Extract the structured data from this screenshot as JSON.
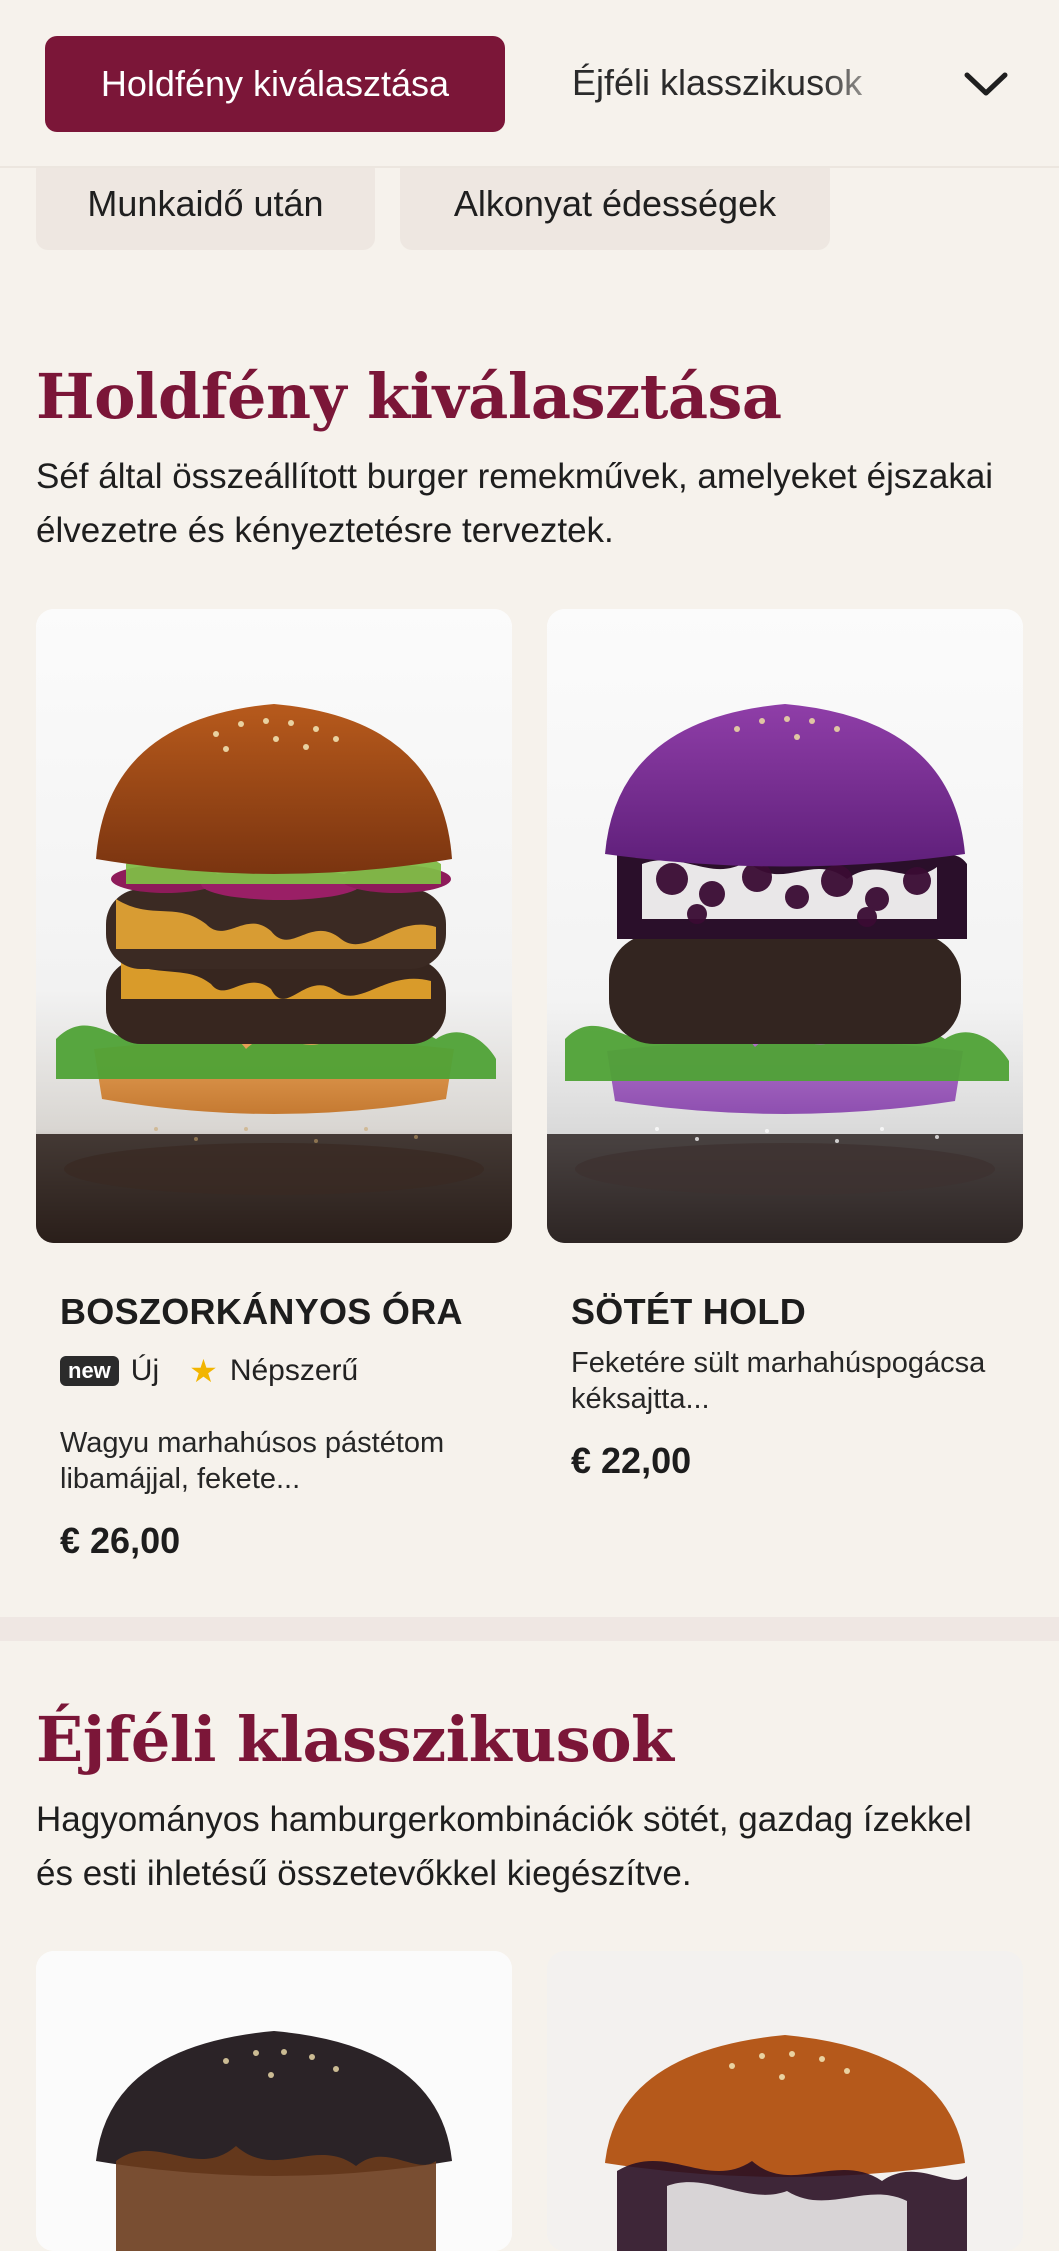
{
  "category_bar": {
    "active_label": "Holdfény kiválasztása",
    "next_label": "Éjféli klasszikusok"
  },
  "chips": [
    {
      "label": "Munkaidő után"
    },
    {
      "label": "Alkonyat édességek"
    }
  ],
  "sections": [
    {
      "title": "Holdfény kiválasztása",
      "description": "Séf által összeállított burger remekművek, amelyeket éjszakai élvezetre és kényeztetésre terveztek.",
      "items": [
        {
          "name": "BOSZORKÁNYOS ÓRA",
          "badge_new": "new",
          "tag_new": "Új",
          "tag_popular": "Népszerű",
          "description": "Wagyu marhahúsos pástétom libamájjal, fekete...",
          "price": "€ 26,00"
        },
        {
          "name": "SÖTÉT HOLD",
          "description": "Feketére sült marhahúspogácsa kéksajtta...",
          "price": "€ 22,00"
        }
      ]
    },
    {
      "title": "Éjféli klasszikusok",
      "description": "Hagyományos hamburgerkombinációk sötét, gazdag ízekkel és esti ihletésű összetevőkkel kiegészítve."
    }
  ],
  "colors": {
    "accent": "#7b1638",
    "background": "#f6f2ec",
    "chip": "#eee7e1",
    "star": "#f2b500"
  },
  "icons": {
    "dropdown": "chevron-down-icon",
    "popular": "star-icon"
  }
}
